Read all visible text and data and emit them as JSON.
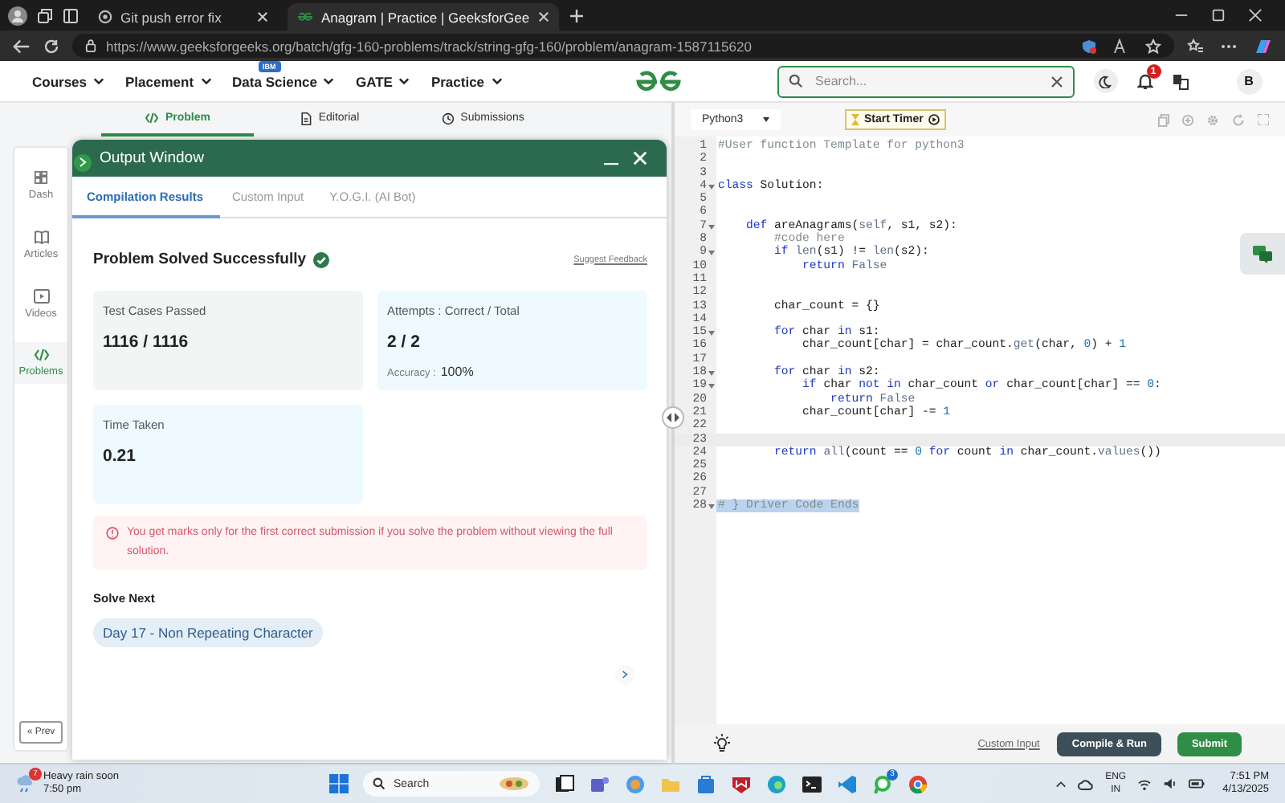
{
  "browser": {
    "tabs": [
      {
        "title": "Git push error fix",
        "selected": false
      },
      {
        "title": "Anagram | Practice | GeeksforGee",
        "selected": true
      }
    ],
    "url": "https://www.geeksforgeeks.org/batch/gfg-160-problems/track/string-gfg-160/problem/anagram-1587115620"
  },
  "site_nav": {
    "menu": [
      {
        "label": "Courses"
      },
      {
        "label": "Placement"
      },
      {
        "label": "Data Science",
        "badge": "IBM"
      },
      {
        "label": "GATE"
      },
      {
        "label": "Practice"
      }
    ],
    "search": {
      "placeholder": "Search..."
    },
    "notifications": "1",
    "avatar": "B"
  },
  "problem_tabs": [
    {
      "label": "Problem",
      "selected": true
    },
    {
      "label": "Editorial",
      "selected": false
    },
    {
      "label": "Submissions",
      "selected": false
    }
  ],
  "sidebar": {
    "items": [
      {
        "label": "Dash",
        "selected": false
      },
      {
        "label": "Articles",
        "selected": false
      },
      {
        "label": "Videos",
        "selected": false
      },
      {
        "label": "Problems",
        "selected": true
      }
    ],
    "prev_button": "« Prev"
  },
  "output_window": {
    "title": "Output Window",
    "tabs": [
      {
        "label": "Compilation Results",
        "selected": true
      },
      {
        "label": "Custom Input",
        "selected": false
      },
      {
        "label": "Y.O.G.I. (AI Bot)",
        "selected": false
      }
    ],
    "status": "Problem Solved Successfully",
    "feedback_link": "Suggest Feedback",
    "stats": [
      {
        "label": "Test Cases Passed",
        "value": "1116 / 1116"
      },
      {
        "label": "Attempts : Correct / Total",
        "value": "2 / 2",
        "note_label": "Accuracy :",
        "note_value": "100%"
      },
      {
        "label": "Time Taken",
        "value": "0.21"
      }
    ],
    "notice": "You get marks only for the first correct submission if you solve the problem without viewing the full solution.",
    "solve_next": {
      "heading": "Solve Next",
      "items": [
        "Day 17 - Non Repeating Character"
      ]
    }
  },
  "editor": {
    "language": "Python3",
    "timer_button": "Start Timer",
    "lines": [
      {
        "number": "1",
        "kind": "plain",
        "fold": false,
        "tokens": [
          {
            "kind": "comment",
            "text": "#User function Template for python3"
          }
        ]
      },
      {
        "number": "2",
        "kind": "plain",
        "fold": false
      },
      {
        "number": "3",
        "kind": "plain",
        "fold": false
      },
      {
        "number": "4",
        "kind": "plain",
        "fold": true,
        "tokens": [
          {
            "kind": "keyword",
            "text": "class"
          },
          {
            "kind": "text",
            "text": " Solution:"
          }
        ]
      },
      {
        "number": "5",
        "kind": "plain",
        "fold": false
      },
      {
        "number": "6",
        "kind": "plain",
        "fold": false
      },
      {
        "number": "7",
        "kind": "plain",
        "fold": true,
        "tokens": [
          {
            "kind": "keyword",
            "text": "    def"
          },
          {
            "kind": "text",
            "text": " areAnagrams("
          },
          {
            "kind": "builtin",
            "text": "self"
          },
          {
            "kind": "text",
            "text": ", s1, s2):"
          }
        ]
      },
      {
        "number": "8",
        "kind": "plain",
        "fold": false,
        "tokens": [
          {
            "kind": "comment",
            "text": "        #code here"
          }
        ]
      },
      {
        "number": "9",
        "kind": "plain",
        "fold": true,
        "tokens": [
          {
            "kind": "keyword",
            "text": "        if "
          },
          {
            "kind": "builtin",
            "text": "len"
          },
          {
            "kind": "text",
            "text": "(s1) != "
          },
          {
            "kind": "builtin",
            "text": "len"
          },
          {
            "kind": "text",
            "text": "(s2):"
          }
        ]
      },
      {
        "number": "10",
        "kind": "plain",
        "fold": false,
        "tokens": [
          {
            "kind": "keyword",
            "text": "            return "
          },
          {
            "kind": "builtin",
            "text": "False"
          }
        ]
      },
      {
        "number": "11",
        "kind": "plain",
        "fold": false
      },
      {
        "number": "12",
        "kind": "plain",
        "fold": false
      },
      {
        "number": "13",
        "kind": "plain",
        "fold": false,
        "tokens": [
          {
            "kind": "text",
            "text": "        char_count = {}"
          }
        ]
      },
      {
        "number": "14",
        "kind": "plain",
        "fold": false
      },
      {
        "number": "15",
        "kind": "plain",
        "fold": true,
        "tokens": [
          {
            "kind": "keyword",
            "text": "        for"
          },
          {
            "kind": "text",
            "text": " char "
          },
          {
            "kind": "keyword",
            "text": "in"
          },
          {
            "kind": "text",
            "text": " s1:"
          }
        ]
      },
      {
        "number": "16",
        "kind": "plain",
        "fold": false,
        "tokens": [
          {
            "kind": "text",
            "text": "            char_count[char] = char_count."
          },
          {
            "kind": "builtin",
            "text": "get"
          },
          {
            "kind": "text",
            "text": "(char, "
          },
          {
            "kind": "number",
            "text": "0"
          },
          {
            "kind": "text",
            "text": ") + "
          },
          {
            "kind": "number",
            "text": "1"
          }
        ]
      },
      {
        "number": "17",
        "kind": "plain",
        "fold": false
      },
      {
        "number": "18",
        "kind": "plain",
        "fold": true,
        "tokens": [
          {
            "kind": "keyword",
            "text": "        for"
          },
          {
            "kind": "text",
            "text": " char "
          },
          {
            "kind": "keyword",
            "text": "in"
          },
          {
            "kind": "text",
            "text": " s2:"
          }
        ]
      },
      {
        "number": "19",
        "kind": "plain",
        "fold": true,
        "tokens": [
          {
            "kind": "keyword",
            "text": "            if"
          },
          {
            "kind": "text",
            "text": " char "
          },
          {
            "kind": "keyword",
            "text": "not in"
          },
          {
            "kind": "text",
            "text": " char_count "
          },
          {
            "kind": "keyword",
            "text": "or"
          },
          {
            "kind": "text",
            "text": " char_count[char] == "
          },
          {
            "kind": "number",
            "text": "0"
          },
          {
            "kind": "text",
            "text": ":"
          }
        ]
      },
      {
        "number": "20",
        "kind": "plain",
        "fold": false,
        "tokens": [
          {
            "kind": "keyword",
            "text": "                return "
          },
          {
            "kind": "builtin",
            "text": "False"
          }
        ]
      },
      {
        "number": "21",
        "kind": "plain",
        "fold": false,
        "tokens": [
          {
            "kind": "text",
            "text": "            char_count[char] -= "
          },
          {
            "kind": "number",
            "text": "1"
          }
        ]
      },
      {
        "number": "22",
        "kind": "plain",
        "fold": false
      },
      {
        "number": "23",
        "kind": "active",
        "fold": false
      },
      {
        "number": "24",
        "kind": "plain",
        "fold": false,
        "tokens": [
          {
            "kind": "keyword",
            "text": "        return "
          },
          {
            "kind": "builtin",
            "text": "all"
          },
          {
            "kind": "text",
            "text": "(count == "
          },
          {
            "kind": "number",
            "text": "0 "
          },
          {
            "kind": "keyword",
            "text": "for"
          },
          {
            "kind": "text",
            "text": " count "
          },
          {
            "kind": "keyword",
            "text": "in"
          },
          {
            "kind": "text",
            "text": " char_count."
          },
          {
            "kind": "builtin",
            "text": "values"
          },
          {
            "kind": "text",
            "text": "())"
          }
        ]
      },
      {
        "number": "25",
        "kind": "plain",
        "fold": false
      },
      {
        "number": "26",
        "kind": "plain",
        "fold": false
      },
      {
        "number": "27",
        "kind": "plain",
        "fold": false
      },
      {
        "number": "28",
        "kind": "selected",
        "fold": true,
        "tokens": [
          {
            "kind": "comment",
            "text": "# } Driver Code Ends"
          }
        ]
      }
    ],
    "custom_input_link": "Custom Input",
    "buttons": [
      {
        "kind": "run",
        "label": "Compile & Run"
      },
      {
        "kind": "submit",
        "label": "Submit"
      }
    ]
  },
  "taskbar": {
    "weather": {
      "badge": "7",
      "title": "Heavy rain soon",
      "time": "7:50 pm"
    },
    "search_placeholder": "Search",
    "chat_badge": "3",
    "language": [
      "ENG",
      "IN"
    ],
    "time": "7:51 PM",
    "date": "4/13/2025"
  }
}
